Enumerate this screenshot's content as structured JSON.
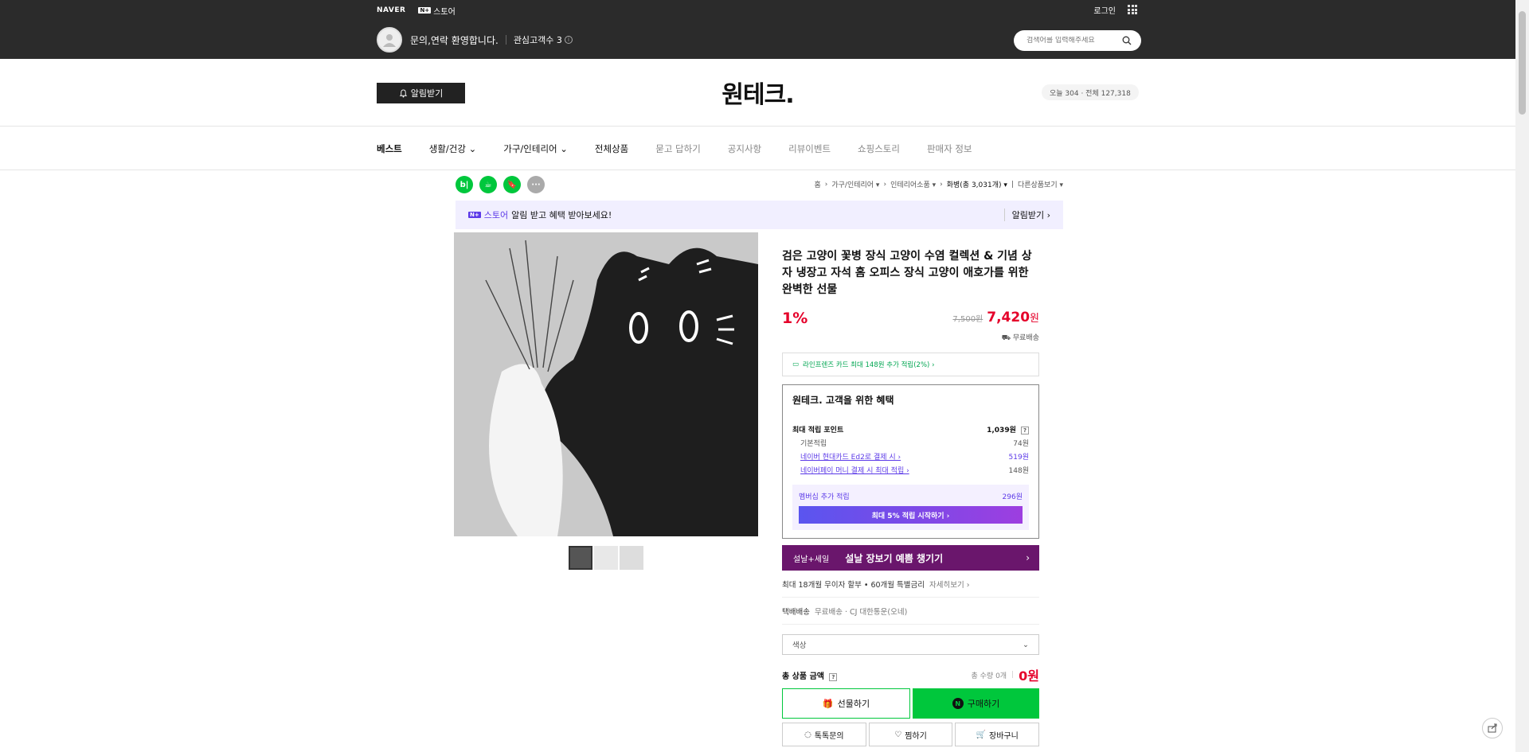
{
  "topbar": {
    "naver": "NAVER",
    "n_badge": "N+",
    "store": "스토어",
    "login": "로그인",
    "welcome": "문의,연락 환영합니다.",
    "interest": "관심고객수 3",
    "info": "i",
    "search_placeholder": "검색어를 입력해주세요"
  },
  "header": {
    "alarm_label": "알림받기",
    "brand": "원테크.",
    "visitors": "오늘 304 · 전체 127,318"
  },
  "nav": {
    "items": [
      {
        "label": "베스트"
      },
      {
        "label": "생활/건강 ⌄"
      },
      {
        "label": "가구/인테리어 ⌄"
      },
      {
        "label": "전체상품"
      },
      {
        "label": "묻고 답하기"
      },
      {
        "label": "공지사항"
      },
      {
        "label": "리뷰이벤트"
      },
      {
        "label": "쇼핑스토리"
      },
      {
        "label": "판매자 정보"
      }
    ]
  },
  "share": {
    "blog": "b|",
    "cafe": "☕",
    "bookmark": "🔖",
    "more": "···"
  },
  "breadcrumb": {
    "home": "홈",
    "cat1": "가구/인테리어 ▾",
    "cat2": "인테리어소품 ▾",
    "current": "화병(총 3,031개) ▾",
    "other": "다른상품보기 ▾"
  },
  "promo": {
    "badge": "N+",
    "store": "스토어",
    "text": "알림 받고 혜택 받아보세요!",
    "right": "알림받기 ›"
  },
  "product": {
    "title": "검은 고양이 꽃병 장식 고양이 수염 컬렉션 & 기념 상자 냉장고 자석 홈 오피스 장식 고양이 애호가를 위한 완벽한 선물",
    "discount": "1%",
    "original_price": "7,500원",
    "final_price": "7,420",
    "won": "원",
    "delivery": "무료배송",
    "card_promo": "라인프렌즈 카드 최대 148원 추가 적립(2%) ›"
  },
  "benefit": {
    "heading": "원테크. 고객을 위한 혜택",
    "max_point_label": "최대 적립 포인트",
    "max_point_value": "1,039원",
    "help": "?",
    "rows": [
      {
        "label": "기본적립",
        "value": "74원"
      },
      {
        "label": "네이버 현대카드 Ed2로 결제 시 ›",
        "value": "519원"
      },
      {
        "label": "네이버페이 머니 결제 시 최대 적립 ›",
        "value": "148원"
      }
    ],
    "membership_label": "멤버십 추가 적립",
    "membership_value": "296원",
    "membership_button": "최대 5% 적립 시작하기 ›"
  },
  "sale_banner": {
    "tag": "설날+세일",
    "text": "설날 장보기 예쁨 챙기기",
    "arrow": "›"
  },
  "installment": {
    "text": "최대 18개월 무이자 할부 • 60개월 특별금리",
    "link": "자세히보기 ›"
  },
  "shipping": {
    "label": "택배배송",
    "value": "무료배송 · CJ 대한통운(오네)"
  },
  "option": {
    "placeholder": "색상"
  },
  "total": {
    "label": "총 상품 금액",
    "help": "?",
    "qty": "총 수량 0개",
    "amount": "0원"
  },
  "buttons": {
    "gift": "선물하기",
    "buy": "구매하기",
    "talk": "톡톡문의",
    "wish": "찜하기",
    "cart": "장바구니"
  },
  "colors": {
    "accent_green": "#00c73c",
    "price_red": "#e5002a",
    "store_purple": "#5c3ae8"
  }
}
